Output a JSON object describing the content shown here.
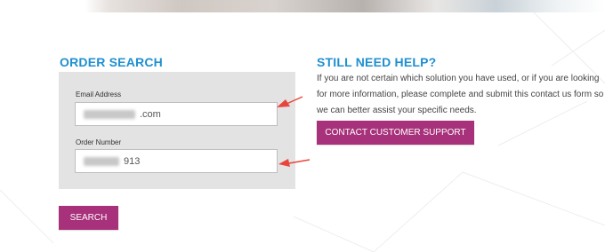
{
  "order_search": {
    "title": "ORDER SEARCH",
    "email_label": "Email Address",
    "email_value": ".com",
    "order_label": "Order Number",
    "order_value": "913",
    "search_button": "SEARCH"
  },
  "help": {
    "title": "STILL NEED HELP?",
    "text": "If you are not certain which solution you have used, or if you are looking for more information, please complete and submit this contact us form so we can better assist your specific needs.",
    "contact_button": "CONTACT CUSTOMER SUPPORT"
  },
  "colors": {
    "heading_blue": "#1e8fd0",
    "button_magenta": "#a7317a",
    "panel_gray": "#e3e3e3",
    "annotation_red": "#e8453c"
  }
}
